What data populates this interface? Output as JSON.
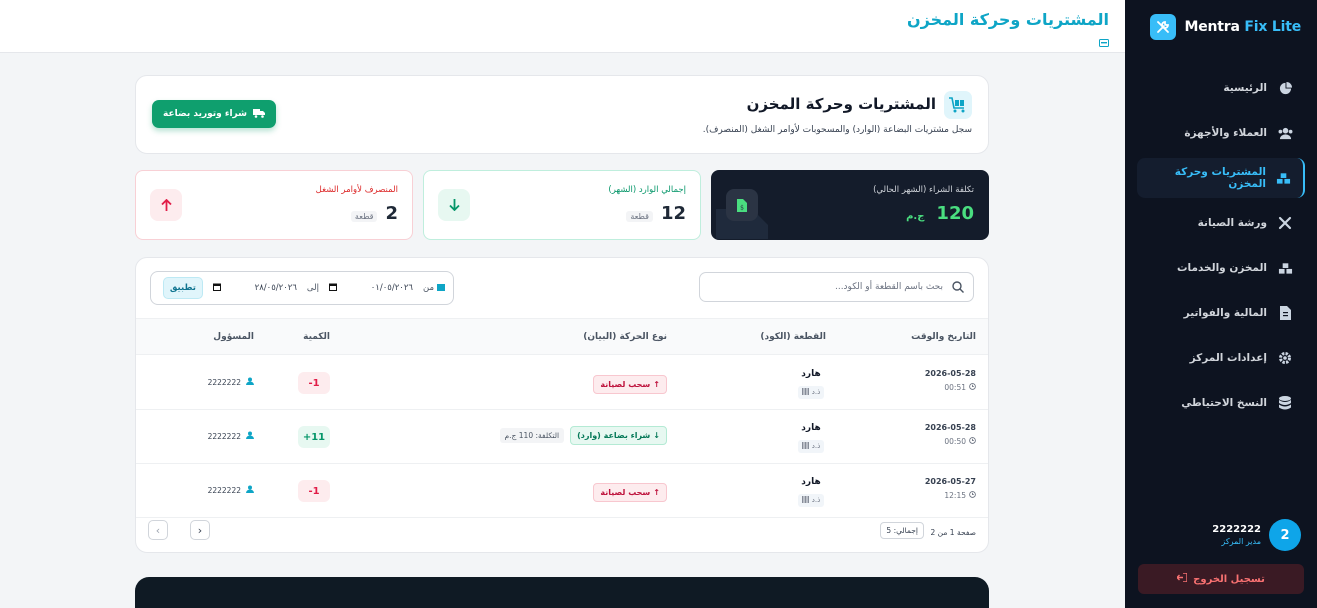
{
  "brand": {
    "name_main": "Mentra",
    "name_accent": "Fix Lite"
  },
  "sidebar": {
    "items": [
      {
        "label": "الرئيسية",
        "icon": "chart-pie-icon"
      },
      {
        "label": "العملاء والأجهزة",
        "icon": "users-icon"
      },
      {
        "label": "المشتريات وحركة المخزن",
        "icon": "boxes-icon"
      },
      {
        "label": "ورشة الصيانة",
        "icon": "tools-icon"
      },
      {
        "label": "المخزن والخدمات",
        "icon": "boxes-stack-icon"
      },
      {
        "label": "المالية والفواتير",
        "icon": "invoice-icon"
      },
      {
        "label": "إعدادات المركز",
        "icon": "gear-icon"
      },
      {
        "label": "النسخ الاحتياطي",
        "icon": "database-icon"
      }
    ],
    "active_index": 2,
    "user": {
      "avatar_initial": "2",
      "name": "2222222",
      "role": "مدير المركز"
    },
    "logout_label": "تسجيل الخروج"
  },
  "topbar": {
    "title": "المشتريات وحركة المخزن"
  },
  "header": {
    "title": "المشتريات وحركة المخزن",
    "description": "سجل مشتريات البضاعة (الوارد) والمسحوبات لأوامر الشغل (المنصرف).",
    "buy_button": "شراء وتوريد بضاعة"
  },
  "stats": {
    "cost": {
      "label": "تكلفة الشراء (الشهر الحالي)",
      "value": "120",
      "unit": "ج.م"
    },
    "incoming": {
      "label": "إجمالي الوارد (الشهر)",
      "value": "12",
      "unit": "قطعة"
    },
    "outgoing": {
      "label": "المنصرف لأوامر الشغل",
      "value": "2",
      "unit": "قطعة"
    }
  },
  "filters": {
    "search_placeholder": "بحث باسم القطعة أو الكود...",
    "from_label": "من",
    "from_value": "٠١/٠٥/٢٠٢٦",
    "to_label": "إلى",
    "to_value": "٢٨/٠٥/٢٠٢٦",
    "apply_label": "تطبيق"
  },
  "table": {
    "headers": {
      "datetime": "التاريخ والوقت",
      "part": "القطعة (الكود)",
      "type": "نوع الحركة (البيان)",
      "qty": "الكمية",
      "responsible": "المسؤول"
    },
    "rows": [
      {
        "date": "2026-05-28",
        "time": "00:51",
        "part": "هارد",
        "code": "ذ.د",
        "type": "سحب لصيانة",
        "direction": "out",
        "cost": "",
        "qty": "-1",
        "responsible": "2222222"
      },
      {
        "date": "2026-05-28",
        "time": "00:50",
        "part": "هارد",
        "code": "ذ.د",
        "type": "شراء بضاعة (وارد)",
        "direction": "in",
        "cost": "التكلفة: 110 ج.م",
        "qty": "+11",
        "responsible": "2222222"
      },
      {
        "date": "2026-05-27",
        "time": "12:15",
        "part": "هارد",
        "code": "ذ.د",
        "type": "سحب لصيانة",
        "direction": "out",
        "cost": "",
        "qty": "-1",
        "responsible": "2222222"
      }
    ]
  },
  "pager": {
    "page_text": "صفحة 1 من 2",
    "total_text": "إجمالي: 5"
  },
  "colors": {
    "accent": "#0ea5c6",
    "success": "#0f9f6e",
    "danger": "#e11d48",
    "sidebar_bg": "#0d1320"
  }
}
